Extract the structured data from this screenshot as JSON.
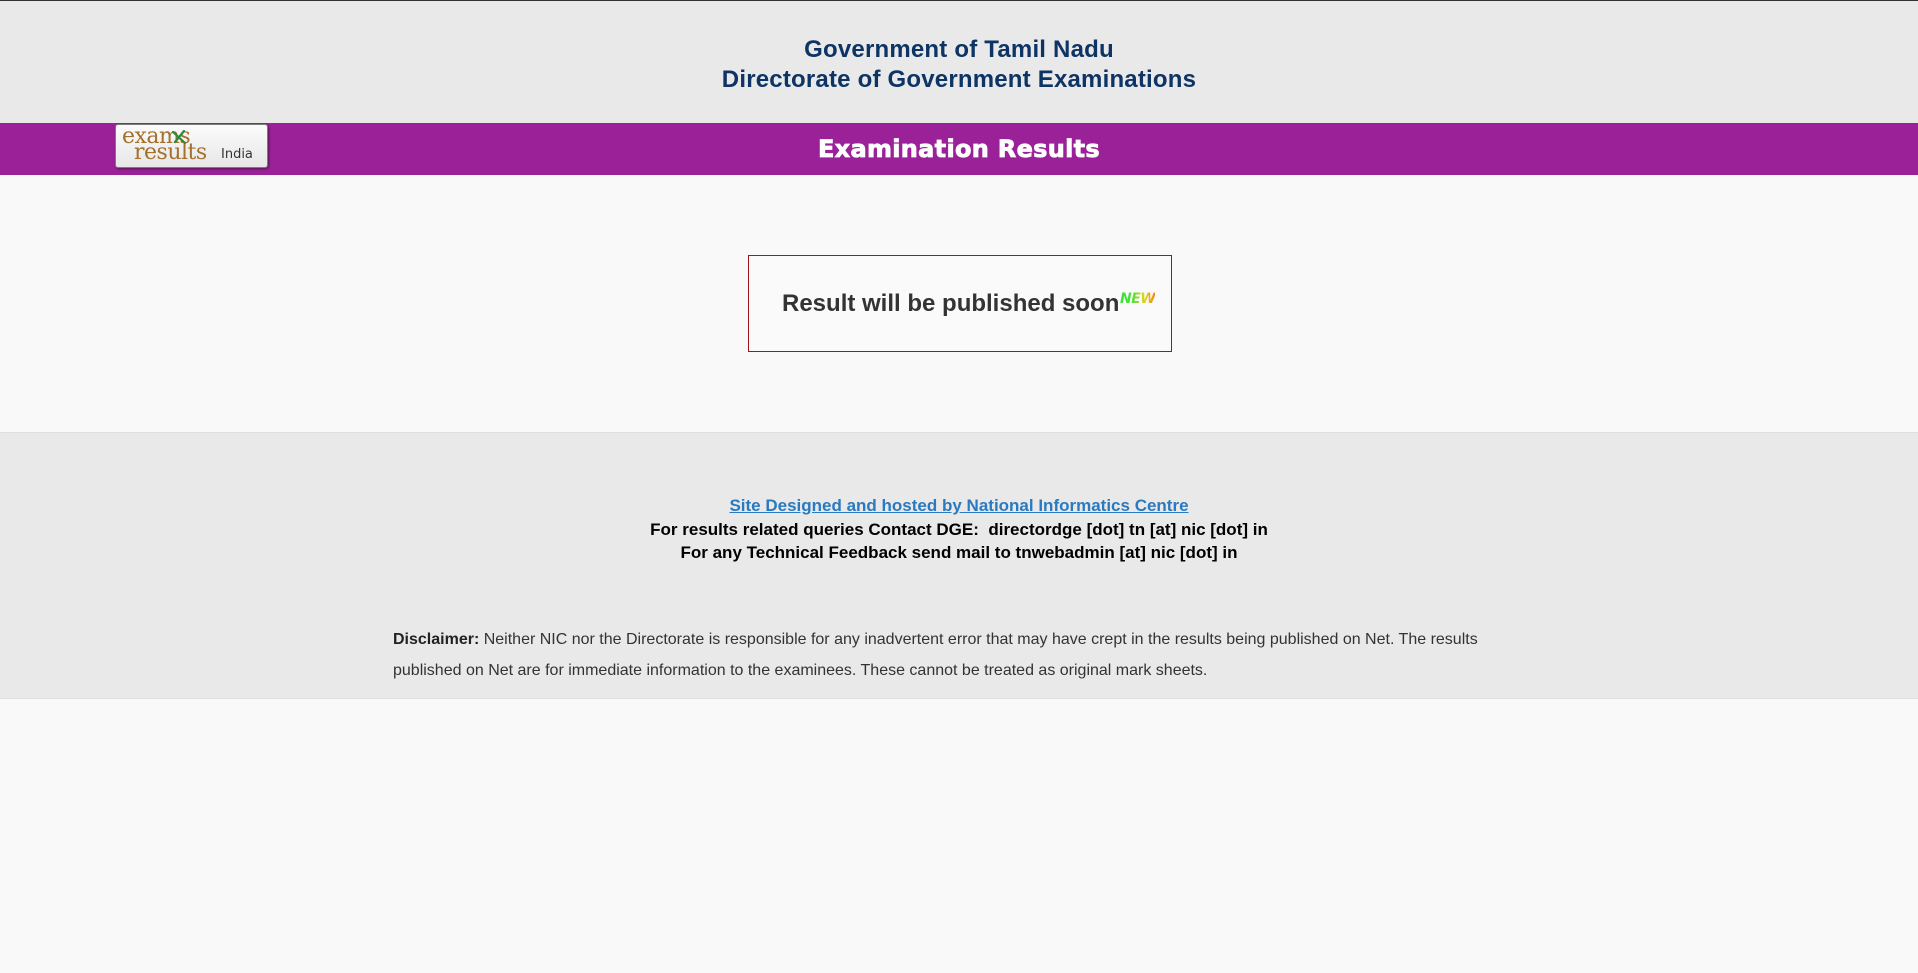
{
  "header": {
    "line1": "Government of Tamil Nadu",
    "line2": "Directorate of Government Examinations"
  },
  "banner": {
    "logo": {
      "word1": "exams",
      "word2": "results",
      "word3": "India"
    },
    "title": "Examination Results"
  },
  "main": {
    "result_message": "Result will be published soon",
    "new_badge": "NEW"
  },
  "footer": {
    "nic_link": "Site Designed and hosted by National Informatics Centre",
    "contact_dge": "For results related queries Contact DGE:  directordge [dot] tn [at] nic [dot] in",
    "technical_feedback": "For any Technical Feedback send mail to tnwebadmin [at] nic [dot] in",
    "disclaimer_label": "Disclaimer:",
    "disclaimer_text": " Neither NIC nor the Directorate is responsible for any inadvertent error that may have crept in the results being published on Net. The results published on Net are for immediate information to the examinees. These cannot be treated as original mark sheets."
  },
  "colors": {
    "header_text": "#0d3464",
    "banner_bg": "#9a2197",
    "result_border": "#a3141c",
    "link": "#2a7ac0"
  }
}
